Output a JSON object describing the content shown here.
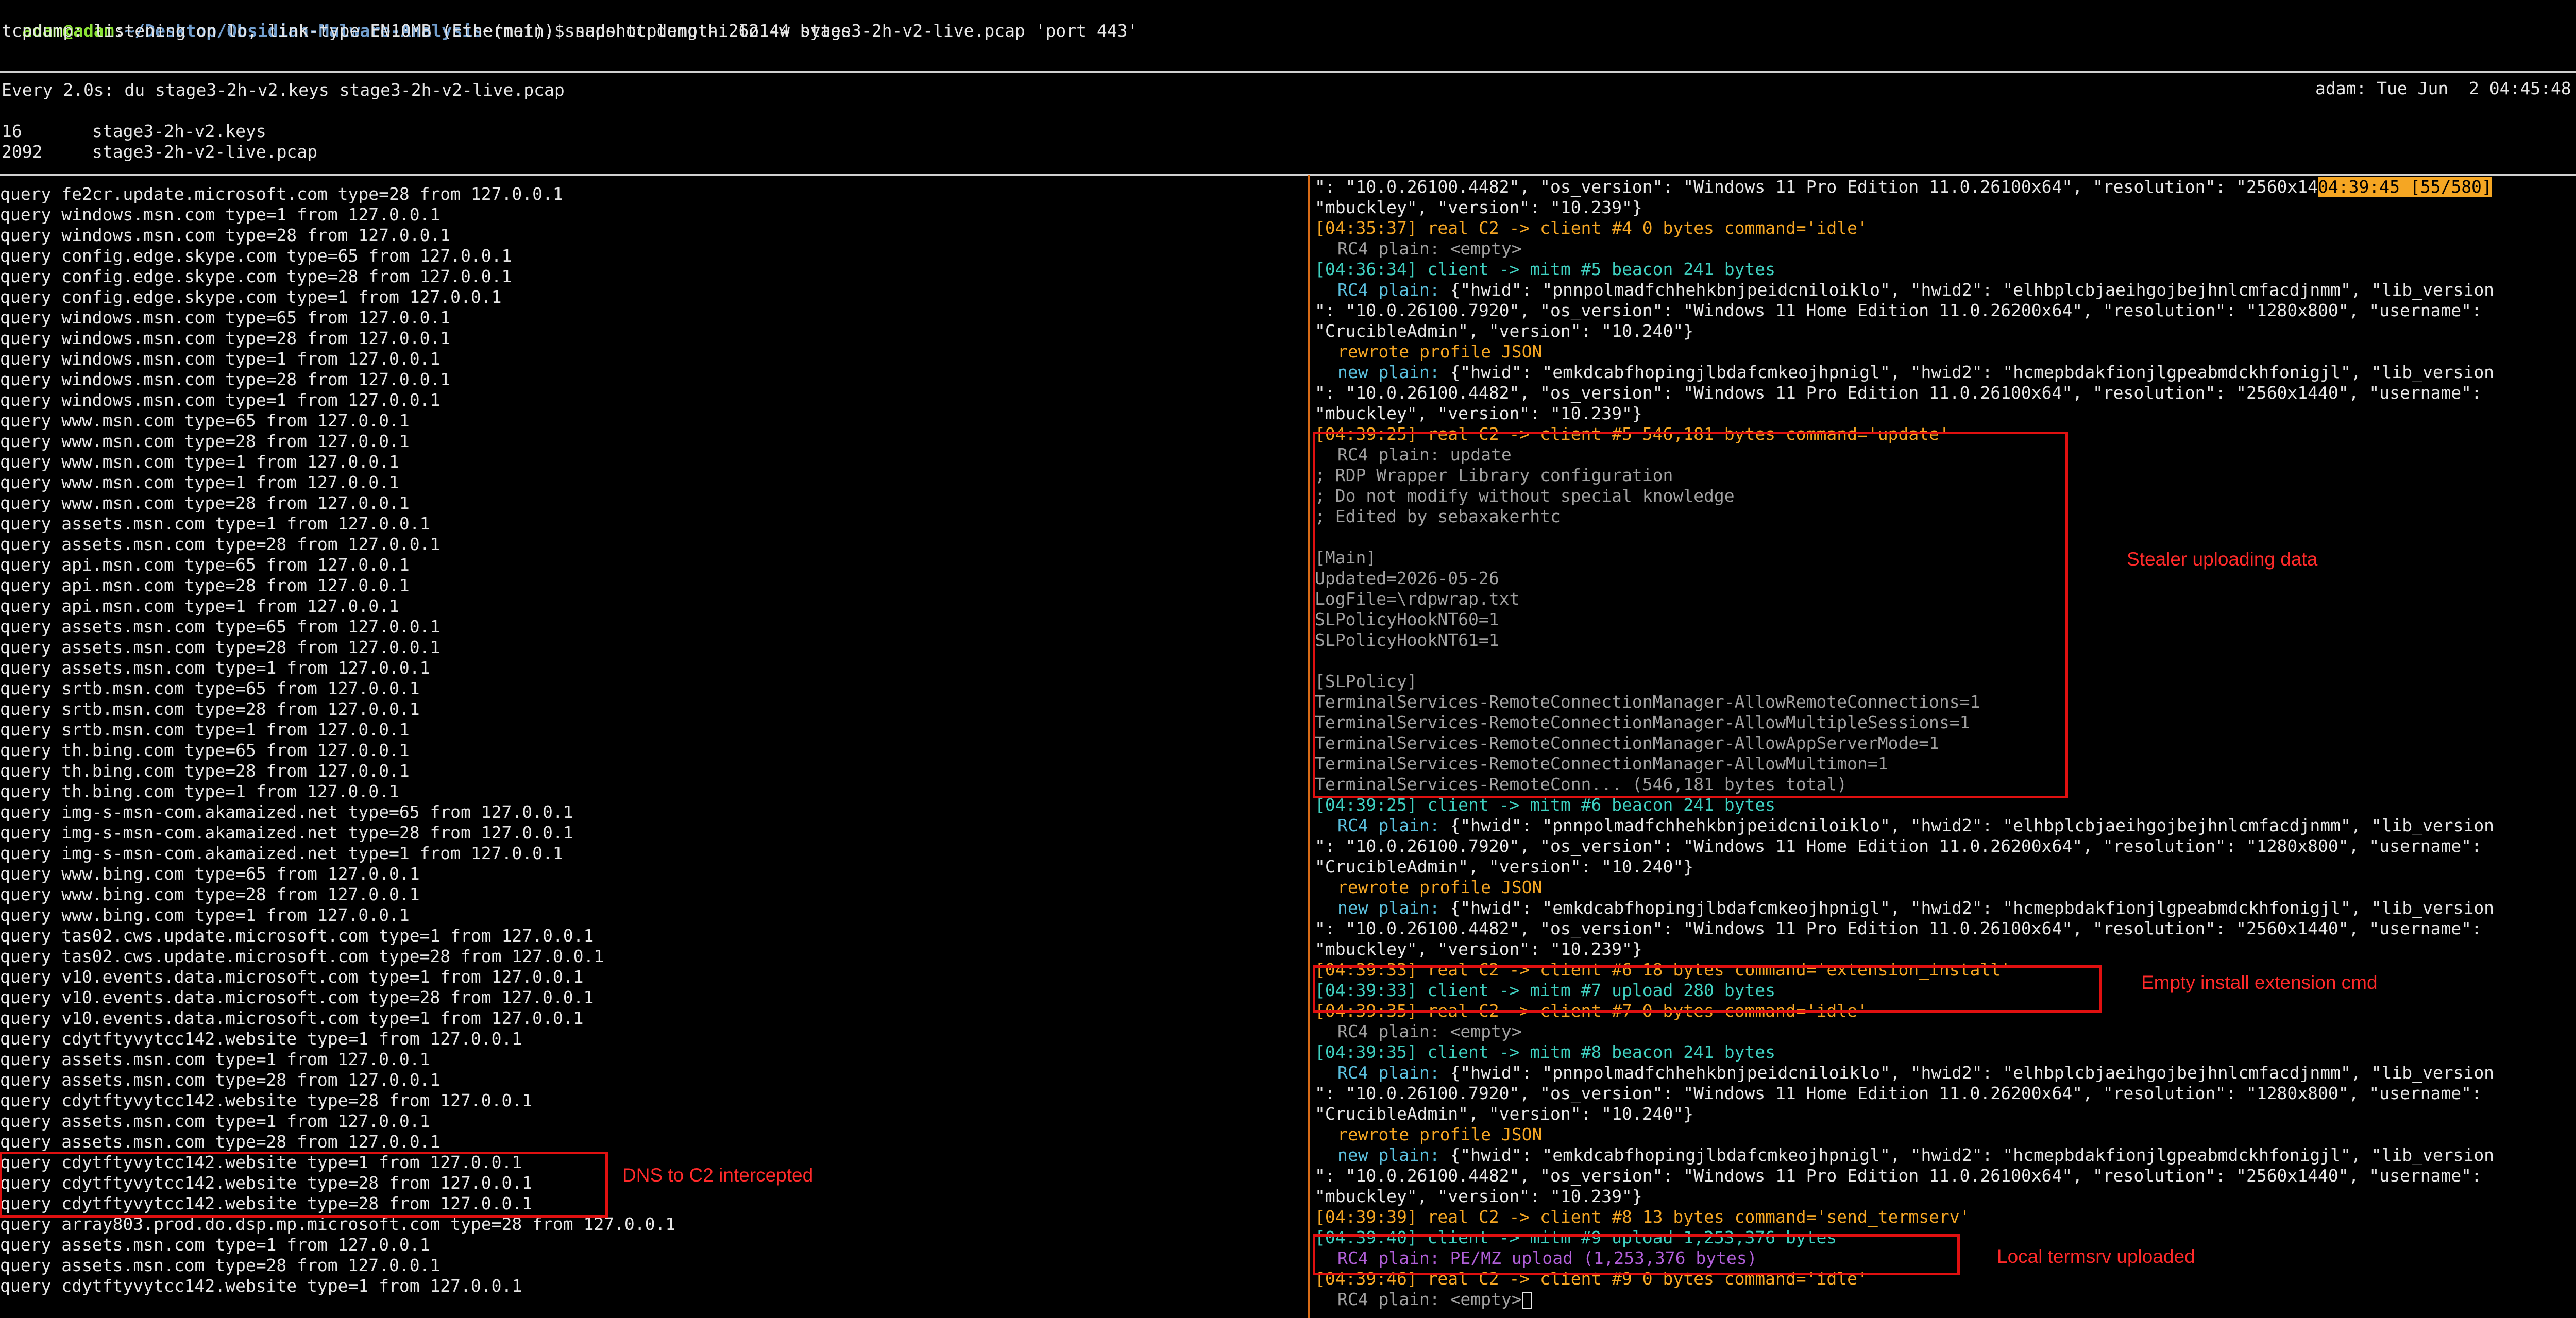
{
  "terminal": {
    "prompt_user": "adam@adam",
    "prompt_sep": ":",
    "prompt_path": "~/Desktop/Obsidian-Malware-Analysis",
    "prompt_branch": "~(main)$ ",
    "command": "sudo tcpdump -i lo -w stage3-2h-v2-live.pcap 'port 443'",
    "tcpdump_status": "tcpdump: listening on lo, link-type EN10MB (Ethernet), snapshot length 262144 bytes"
  },
  "watch": {
    "header": "Every 2.0s: du stage3-2h-v2.keys stage3-2h-v2-live.pcap",
    "right": "adam: Tue Jun  2 04:45:48 2026",
    "rows": [
      {
        "size": "16",
        "file": "stage3-2h-v2.keys"
      },
      {
        "size": "2092",
        "file": "stage3-2h-v2-live.pcap"
      }
    ]
  },
  "dns_queries": [
    "query fe2cr.update.microsoft.com type=28 from 127.0.0.1",
    "query windows.msn.com type=1 from 127.0.0.1",
    "query windows.msn.com type=28 from 127.0.0.1",
    "query config.edge.skype.com type=65 from 127.0.0.1",
    "query config.edge.skype.com type=28 from 127.0.0.1",
    "query config.edge.skype.com type=1 from 127.0.0.1",
    "query windows.msn.com type=65 from 127.0.0.1",
    "query windows.msn.com type=28 from 127.0.0.1",
    "query windows.msn.com type=1 from 127.0.0.1",
    "query windows.msn.com type=28 from 127.0.0.1",
    "query windows.msn.com type=1 from 127.0.0.1",
    "query www.msn.com type=65 from 127.0.0.1",
    "query www.msn.com type=28 from 127.0.0.1",
    "query www.msn.com type=1 from 127.0.0.1",
    "query www.msn.com type=1 from 127.0.0.1",
    "query www.msn.com type=28 from 127.0.0.1",
    "query assets.msn.com type=1 from 127.0.0.1",
    "query assets.msn.com type=28 from 127.0.0.1",
    "query api.msn.com type=65 from 127.0.0.1",
    "query api.msn.com type=28 from 127.0.0.1",
    "query api.msn.com type=1 from 127.0.0.1",
    "query assets.msn.com type=65 from 127.0.0.1",
    "query assets.msn.com type=28 from 127.0.0.1",
    "query assets.msn.com type=1 from 127.0.0.1",
    "query srtb.msn.com type=65 from 127.0.0.1",
    "query srtb.msn.com type=28 from 127.0.0.1",
    "query srtb.msn.com type=1 from 127.0.0.1",
    "query th.bing.com type=65 from 127.0.0.1",
    "query th.bing.com type=28 from 127.0.0.1",
    "query th.bing.com type=1 from 127.0.0.1",
    "query img-s-msn-com.akamaized.net type=65 from 127.0.0.1",
    "query img-s-msn-com.akamaized.net type=28 from 127.0.0.1",
    "query img-s-msn-com.akamaized.net type=1 from 127.0.0.1",
    "query www.bing.com type=65 from 127.0.0.1",
    "query www.bing.com type=28 from 127.0.0.1",
    "query www.bing.com type=1 from 127.0.0.1",
    "query tas02.cws.update.microsoft.com type=1 from 127.0.0.1",
    "query tas02.cws.update.microsoft.com type=28 from 127.0.0.1",
    "query v10.events.data.microsoft.com type=1 from 127.0.0.1",
    "query v10.events.data.microsoft.com type=28 from 127.0.0.1",
    "query v10.events.data.microsoft.com type=1 from 127.0.0.1",
    "query cdytftyvytcc142.website type=1 from 127.0.0.1",
    "query assets.msn.com type=1 from 127.0.0.1",
    "query assets.msn.com type=28 from 127.0.0.1",
    "query cdytftyvytcc142.website type=28 from 127.0.0.1",
    "query assets.msn.com type=1 from 127.0.0.1",
    "query assets.msn.com type=28 from 127.0.0.1",
    "query cdytftyvytcc142.website type=1 from 127.0.0.1",
    "query cdytftyvytcc142.website type=28 from 127.0.0.1",
    "query cdytftyvytcc142.website type=28 from 127.0.0.1",
    "query array803.prod.do.dsp.mp.microsoft.com type=28 from 127.0.0.1",
    "query assets.msn.com type=1 from 127.0.0.1",
    "query assets.msn.com type=28 from 127.0.0.1",
    "query cdytftyvytcc142.website type=1 from 127.0.0.1"
  ],
  "mitm_log": {
    "line0_text": "\": \"10.0.26100.4482\", \"os_version\": \"Windows 11 Pro Edition 11.0.26100x64\", \"resolution\": \"2560x14",
    "line0_highlight": "04:39:45 [55/580]",
    "lines": [
      {
        "text": "\"mbuckley\", \"version\": \"10.239\"}",
        "color": "white",
        "indent": false
      },
      {
        "text": "[04:35:37] real C2 -> client #4 0 bytes command='idle'",
        "color": "orange",
        "indent": false
      },
      {
        "text": "RC4 plain: <empty>",
        "color": "gray",
        "indent": true
      },
      {
        "text": "[04:36:34] client -> mitm #5 beacon 241 bytes",
        "color": "teal",
        "indent": false
      },
      {
        "label": "RC4 plain: ",
        "label_color": "cyan",
        "text": "{\"hwid\": \"pnnpolmadfchhehkbnjpeidcniloiklo\", \"hwid2\": \"elhbplcbjaeihgojbejhnlcmfacdjnmm\", \"lib_version",
        "color": "white",
        "indent": true
      },
      {
        "text": "\": \"10.0.26100.7920\", \"os_version\": \"Windows 11 Home Edition 11.0.26200x64\", \"resolution\": \"1280x800\", \"username\":",
        "color": "white",
        "indent": false
      },
      {
        "text": "\"CrucibleAdmin\", \"version\": \"10.240\"}",
        "color": "white",
        "indent": false
      },
      {
        "text": "rewrote profile JSON",
        "color": "orange",
        "indent": true
      },
      {
        "label": "new plain: ",
        "label_color": "cyan",
        "text": "{\"hwid\": \"emkdcabfhopingjlbdafcmkeojhpnigl\", \"hwid2\": \"hcmepbdakfionjlgpeabmdckhfonigjl\", \"lib_version",
        "color": "white",
        "indent": true
      },
      {
        "text": "\": \"10.0.26100.4482\", \"os_version\": \"Windows 11 Pro Edition 11.0.26100x64\", \"resolution\": \"2560x1440\", \"username\":",
        "color": "white",
        "indent": false
      },
      {
        "text": "\"mbuckley\", \"version\": \"10.239\"}",
        "color": "white",
        "indent": false
      },
      {
        "text": "[04:39:25] real C2 -> client #5 546,181 bytes command='update'",
        "color": "orange",
        "indent": false
      },
      {
        "text": "RC4 plain: update",
        "color": "gray",
        "indent": true
      },
      {
        "text": "; RDP Wrapper Library configuration",
        "color": "gray",
        "indent": false
      },
      {
        "text": "; Do not modify without special knowledge",
        "color": "gray",
        "indent": false
      },
      {
        "text": "; Edited by sebaxakerhtc",
        "color": "gray",
        "indent": false
      },
      {
        "text": "",
        "color": "gray",
        "indent": false
      },
      {
        "text": "[Main]",
        "color": "gray",
        "indent": false
      },
      {
        "text": "Updated=2026-05-26",
        "color": "gray",
        "indent": false
      },
      {
        "text": "LogFile=\\rdpwrap.txt",
        "color": "gray",
        "indent": false
      },
      {
        "text": "SLPolicyHookNT60=1",
        "color": "gray",
        "indent": false
      },
      {
        "text": "SLPolicyHookNT61=1",
        "color": "gray",
        "indent": false
      },
      {
        "text": "",
        "color": "gray",
        "indent": false
      },
      {
        "text": "[SLPolicy]",
        "color": "gray",
        "indent": false
      },
      {
        "text": "TerminalServices-RemoteConnectionManager-AllowRemoteConnections=1",
        "color": "gray",
        "indent": false
      },
      {
        "text": "TerminalServices-RemoteConnectionManager-AllowMultipleSessions=1",
        "color": "gray",
        "indent": false
      },
      {
        "text": "TerminalServices-RemoteConnectionManager-AllowAppServerMode=1",
        "color": "gray",
        "indent": false
      },
      {
        "text": "TerminalServices-RemoteConnectionManager-AllowMultimon=1",
        "color": "gray",
        "indent": false
      },
      {
        "text": "TerminalServices-RemoteConn... (546,181 bytes total)",
        "color": "gray",
        "indent": false
      },
      {
        "text": "[04:39:25] client -> mitm #6 beacon 241 bytes",
        "color": "teal",
        "indent": false
      },
      {
        "label": "RC4 plain: ",
        "label_color": "cyan",
        "text": "{\"hwid\": \"pnnpolmadfchhehkbnjpeidcniloiklo\", \"hwid2\": \"elhbplcbjaeihgojbejhnlcmfacdjnmm\", \"lib_version",
        "color": "white",
        "indent": true
      },
      {
        "text": "\": \"10.0.26100.7920\", \"os_version\": \"Windows 11 Home Edition 11.0.26200x64\", \"resolution\": \"1280x800\", \"username\":",
        "color": "white",
        "indent": false
      },
      {
        "text": "\"CrucibleAdmin\", \"version\": \"10.240\"}",
        "color": "white",
        "indent": false
      },
      {
        "text": "rewrote profile JSON",
        "color": "orange",
        "indent": true
      },
      {
        "label": "new plain: ",
        "label_color": "cyan",
        "text": "{\"hwid\": \"emkdcabfhopingjlbdafcmkeojhpnigl\", \"hwid2\": \"hcmepbdakfionjlgpeabmdckhfonigjl\", \"lib_version",
        "color": "white",
        "indent": true
      },
      {
        "text": "\": \"10.0.26100.4482\", \"os_version\": \"Windows 11 Pro Edition 11.0.26100x64\", \"resolution\": \"2560x1440\", \"username\":",
        "color": "white",
        "indent": false
      },
      {
        "text": "\"mbuckley\", \"version\": \"10.239\"}",
        "color": "white",
        "indent": false
      },
      {
        "text": "[04:39:33] real C2 -> client #6 18 bytes command='extension_install'",
        "color": "orange",
        "indent": false
      },
      {
        "text": "[04:39:33] client -> mitm #7 upload 280 bytes",
        "color": "teal",
        "indent": false
      },
      {
        "text": "[04:39:35] real C2 -> client #7 0 bytes command='idle'",
        "color": "orange",
        "indent": false
      },
      {
        "text": "RC4 plain: <empty>",
        "color": "gray",
        "indent": true
      },
      {
        "text": "[04:39:35] client -> mitm #8 beacon 241 bytes",
        "color": "teal",
        "indent": false
      },
      {
        "label": "RC4 plain: ",
        "label_color": "cyan",
        "text": "{\"hwid\": \"pnnpolmadfchhehkbnjpeidcniloiklo\", \"hwid2\": \"elhbplcbjaeihgojbejhnlcmfacdjnmm\", \"lib_version",
        "color": "white",
        "indent": true
      },
      {
        "text": "\": \"10.0.26100.7920\", \"os_version\": \"Windows 11 Home Edition 11.0.26200x64\", \"resolution\": \"1280x800\", \"username\":",
        "color": "white",
        "indent": false
      },
      {
        "text": "\"CrucibleAdmin\", \"version\": \"10.240\"}",
        "color": "white",
        "indent": false
      },
      {
        "text": "rewrote profile JSON",
        "color": "orange",
        "indent": true
      },
      {
        "label": "new plain: ",
        "label_color": "cyan",
        "text": "{\"hwid\": \"emkdcabfhopingjlbdafcmkeojhpnigl\", \"hwid2\": \"hcmepbdakfionjlgpeabmdckhfonigjl\", \"lib_version",
        "color": "white",
        "indent": true
      },
      {
        "text": "\": \"10.0.26100.4482\", \"os_version\": \"Windows 11 Pro Edition 11.0.26100x64\", \"resolution\": \"2560x1440\", \"username\":",
        "color": "white",
        "indent": false
      },
      {
        "text": "\"mbuckley\", \"version\": \"10.239\"}",
        "color": "white",
        "indent": false
      },
      {
        "text": "[04:39:39] real C2 -> client #8 13 bytes command='send_termserv'",
        "color": "orange",
        "indent": false
      },
      {
        "text": "[04:39:40] client -> mitm #9 upload 1,253,376 bytes",
        "color": "teal",
        "indent": false
      },
      {
        "text": "RC4 plain: PE/MZ upload (1,253,376 bytes)",
        "color": "purple",
        "indent": true
      },
      {
        "text": "[04:39:46] real C2 -> client #9 0 bytes command='idle'",
        "color": "orange",
        "indent": false
      },
      {
        "text": "RC4 plain: <empty>",
        "color": "gray",
        "indent": true
      }
    ]
  },
  "annotations": {
    "stealer": "Stealer uploading data",
    "extension": "Empty install extension cmd",
    "dns": "DNS to C2 intercepted",
    "termsrv": "Local termsrv uploaded"
  },
  "colors": {
    "pane_separator": "#d96b16",
    "annotation": "#e01010"
  }
}
